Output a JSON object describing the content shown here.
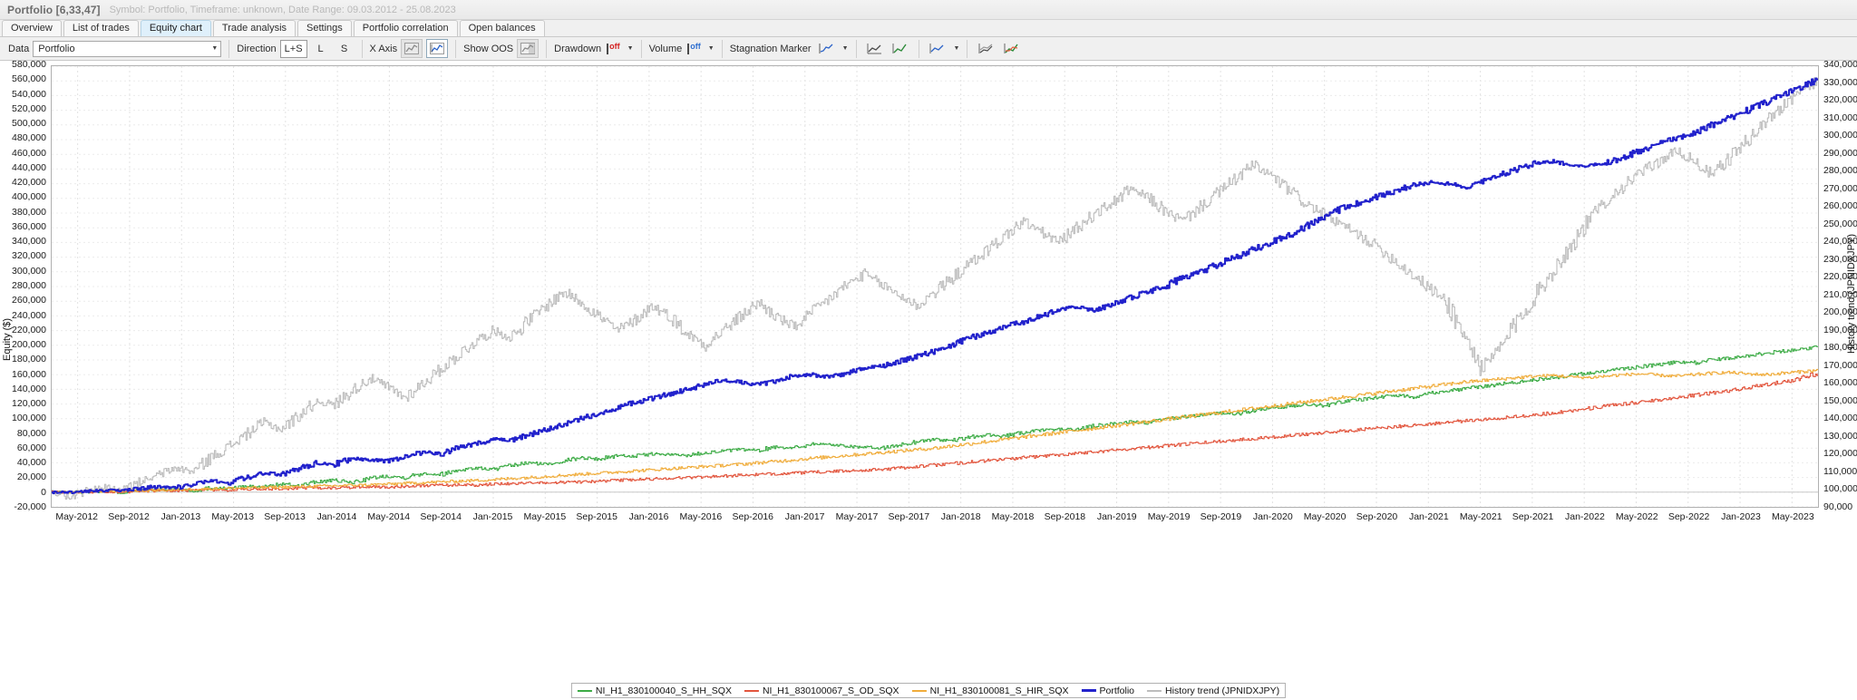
{
  "window": {
    "title": "Portfolio [6,33,47]",
    "subtitle": "Symbol: Portfolio, Timeframe: unknown, Date Range: 09.03.2012 - 25.08.2023"
  },
  "tabs": [
    {
      "label": "Overview",
      "active": false
    },
    {
      "label": "List of trades",
      "active": false
    },
    {
      "label": "Equity chart",
      "active": true
    },
    {
      "label": "Trade analysis",
      "active": false
    },
    {
      "label": "Settings",
      "active": false
    },
    {
      "label": "Portfolio correlation",
      "active": false
    },
    {
      "label": "Open balances",
      "active": false
    }
  ],
  "toolbar": {
    "data_label": "Data",
    "data_value": "Portfolio",
    "direction_label": "Direction",
    "direction_options": [
      "L+S",
      "L",
      "S"
    ],
    "direction_selected": "L+S",
    "xaxis_label": "X Axis",
    "xaxis_icon_1": "chart-line-gray-icon",
    "xaxis_icon_2": "chart-line-time-icon",
    "show_oos_label": "Show OOS",
    "show_oos_icon": "oos-shade-icon",
    "drawdown_label": "Drawdown",
    "drawdown_state": "off",
    "volume_label": "Volume",
    "volume_state": "off",
    "stagnation_label": "Stagnation Marker",
    "stagnation_icon": "stagnation-icon",
    "extra_icons": [
      "equity-line-icon",
      "equity-trend-icon",
      "equity-compare-icon",
      "equity-multi-icon",
      "equity-bars-icon"
    ]
  },
  "chart_data": {
    "type": "line",
    "title": "",
    "xlabel": "",
    "ylabel": "Equity ($)",
    "y2label": "History trend (JPNIDXJPY)",
    "grid": true,
    "legend_position": "bottom",
    "ylim": [
      -20000,
      580000
    ],
    "yticks": [
      -20000,
      0,
      20000,
      40000,
      60000,
      80000,
      100000,
      120000,
      140000,
      160000,
      180000,
      200000,
      220000,
      240000,
      260000,
      280000,
      300000,
      320000,
      340000,
      360000,
      380000,
      400000,
      420000,
      440000,
      460000,
      480000,
      500000,
      520000,
      540000,
      560000,
      580000
    ],
    "ytick_labels": [
      "-20,000",
      "0",
      "20,000",
      "40,000",
      "60,000",
      "80,000",
      "100,000",
      "120,000",
      "140,000",
      "160,000",
      "180,000",
      "200,000",
      "220,000",
      "240,000",
      "260,000",
      "280,000",
      "300,000",
      "320,000",
      "340,000",
      "360,000",
      "380,000",
      "400,000",
      "420,000",
      "440,000",
      "460,000",
      "480,000",
      "500,000",
      "520,000",
      "540,000",
      "560,000",
      "580,000"
    ],
    "y2lim": [
      90000,
      340000
    ],
    "y2ticks": [
      90000,
      100000,
      110000,
      120000,
      130000,
      140000,
      150000,
      160000,
      170000,
      180000,
      190000,
      200000,
      210000,
      220000,
      230000,
      240000,
      250000,
      260000,
      270000,
      280000,
      290000,
      300000,
      310000,
      320000,
      330000,
      340000
    ],
    "y2tick_labels": [
      "90,000",
      "100,000",
      "110,000",
      "120,000",
      "130,000",
      "140,000",
      "150,000",
      "160,000",
      "170,000",
      "180,000",
      "190,000",
      "200,000",
      "210,000",
      "220,000",
      "230,000",
      "240,000",
      "250,000",
      "260,000",
      "270,000",
      "280,000",
      "290,000",
      "300,000",
      "310,000",
      "320,000",
      "330,000",
      "340,000"
    ],
    "xtick_labels": [
      "May-2012",
      "Sep-2012",
      "Jan-2013",
      "May-2013",
      "Sep-2013",
      "Jan-2014",
      "May-2014",
      "Sep-2014",
      "Jan-2015",
      "May-2015",
      "Sep-2015",
      "Jan-2016",
      "May-2016",
      "Sep-2016",
      "Jan-2017",
      "May-2017",
      "Sep-2017",
      "Jan-2018",
      "May-2018",
      "Sep-2018",
      "Jan-2019",
      "May-2019",
      "Sep-2019",
      "Jan-2020",
      "May-2020",
      "Sep-2020",
      "Jan-2021",
      "May-2021",
      "Sep-2021",
      "Jan-2022",
      "May-2022",
      "Sep-2022",
      "Jan-2023",
      "May-2023"
    ],
    "legend": [
      {
        "name": "NI_H1_830100040_S_HH_SQX",
        "color": "#3cab45",
        "axis": "left",
        "width": 1
      },
      {
        "name": "NI_H1_830100067_S_OD_SQX",
        "color": "#e2553d",
        "axis": "left",
        "width": 1
      },
      {
        "name": "NI_H1_830100081_S_HIR_SQX",
        "color": "#f0ac3a",
        "axis": "left",
        "width": 1
      },
      {
        "name": "Portfolio",
        "color": "#2222cc",
        "axis": "left",
        "width": 2
      },
      {
        "name": "History trend (JPNIDXJPY)",
        "color": "#bdbdbd",
        "axis": "right",
        "width": 1
      }
    ],
    "series": [
      {
        "name": "NI_H1_830100040_S_HH_SQX",
        "color": "#3cab45",
        "axis": "left",
        "values": [
          0,
          0,
          500,
          1200,
          -800,
          2500,
          3000,
          4500,
          2000,
          6000,
          5000,
          8000,
          7000,
          11000,
          9000,
          14000,
          16000,
          13000,
          19000,
          22000,
          20000,
          26000,
          24000,
          30000,
          33000,
          31000,
          36000,
          40000,
          38000,
          43000,
          47000,
          45000,
          50000,
          49000,
          52000,
          51000,
          50000,
          54000,
          56000,
          58000,
          57000,
          62000,
          60000,
          66000,
          65000,
          63000,
          61000,
          60000,
          64000,
          69000,
          72000,
          70000,
          75000,
          78000,
          76000,
          81000,
          84000,
          86000,
          85000,
          90000,
          93000,
          96000,
          94000,
          99000,
          102000,
          105000,
          108000,
          106000,
          111000,
          114000,
          117000,
          120000,
          118000,
          123000,
          126000,
          129000,
          132000,
          130000,
          135000,
          138000,
          141000,
          144000,
          147000,
          150000,
          153000,
          156000,
          159000,
          162000,
          165000,
          168000,
          171000,
          174000,
          177000,
          176000,
          180000,
          183000,
          186000,
          189000,
          192000,
          195000,
          198000
        ]
      },
      {
        "name": "NI_H1_830100067_S_OD_SQX",
        "color": "#e2553d",
        "axis": "left",
        "values": [
          0,
          0,
          300,
          800,
          400,
          1500,
          2000,
          1800,
          2600,
          3200,
          2800,
          4000,
          4600,
          4200,
          5400,
          6000,
          5600,
          6800,
          7400,
          7000,
          8200,
          8800,
          9400,
          10000,
          9600,
          11000,
          11600,
          12200,
          12800,
          13400,
          14000,
          15000,
          16000,
          17000,
          18000,
          19000,
          20000,
          21000,
          22000,
          23000,
          24000,
          25000,
          26000,
          27000,
          28000,
          29000,
          30000,
          31000,
          33000,
          35000,
          37000,
          39000,
          41000,
          43000,
          45000,
          47000,
          49000,
          51000,
          53000,
          55000,
          57000,
          59000,
          61000,
          63000,
          65000,
          67000,
          69000,
          71000,
          73000,
          75000,
          77000,
          79000,
          81000,
          83000,
          85000,
          87000,
          89000,
          91000,
          93000,
          95000,
          97000,
          99000,
          101000,
          103000,
          105000,
          108000,
          111000,
          114000,
          117000,
          120000,
          123000,
          126000,
          129000,
          132000,
          135000,
          138000,
          142000,
          146000,
          150000,
          155000,
          162000
        ]
      },
      {
        "name": "NI_H1_830100081_S_HIR_SQX",
        "color": "#f0ac3a",
        "axis": "left",
        "values": [
          0,
          0,
          400,
          1000,
          1600,
          2200,
          2800,
          3400,
          4000,
          4600,
          5200,
          5800,
          6400,
          7000,
          7600,
          8200,
          8800,
          9400,
          10000,
          11000,
          12000,
          13000,
          14000,
          15000,
          16000,
          17000,
          18500,
          20000,
          21500,
          23000,
          24500,
          26000,
          27500,
          29000,
          30500,
          32000,
          33500,
          35000,
          36500,
          38000,
          40000,
          42000,
          44000,
          46000,
          48000,
          50000,
          52000,
          54000,
          56000,
          58000,
          60000,
          63000,
          66000,
          69000,
          72000,
          75000,
          78000,
          81000,
          84000,
          87000,
          90000,
          93000,
          96000,
          99000,
          102000,
          105000,
          108000,
          111000,
          114000,
          117000,
          120000,
          123000,
          126000,
          129000,
          132000,
          135000,
          138000,
          141000,
          144000,
          147000,
          150000,
          152000,
          154000,
          156000,
          158000,
          159000,
          157000,
          156000,
          158000,
          160000,
          161000,
          159000,
          158000,
          160000,
          162000,
          163000,
          161000,
          160000,
          162000,
          164000,
          166000
        ]
      },
      {
        "name": "Portfolio",
        "color": "#2222cc",
        "axis": "left",
        "values": [
          0,
          0,
          1000,
          2500,
          1500,
          5000,
          8000,
          6000,
          11000,
          15000,
          13000,
          20000,
          26000,
          24000,
          32000,
          40000,
          38000,
          46000,
          44000,
          42000,
          48000,
          55000,
          52000,
          60000,
          66000,
          72000,
          70000,
          78000,
          85000,
          92000,
          100000,
          108000,
          115000,
          122000,
          128000,
          134000,
          140000,
          148000,
          152000,
          150000,
          146000,
          152000,
          158000,
          160000,
          157000,
          162000,
          168000,
          172000,
          178000,
          185000,
          192000,
          200000,
          210000,
          218000,
          226000,
          232000,
          240000,
          248000,
          252000,
          248000,
          256000,
          264000,
          272000,
          280000,
          292000,
          300000,
          310000,
          320000,
          330000,
          340000,
          350000,
          362000,
          374000,
          386000,
          394000,
          402000,
          410000,
          418000,
          422000,
          420000,
          416000,
          424000,
          432000,
          440000,
          448000,
          450000,
          446000,
          444000,
          448000,
          456000,
          466000,
          474000,
          482000,
          490000,
          500000,
          510000,
          520000,
          530000,
          540000,
          552000,
          562000
        ]
      },
      {
        "name": "History trend (JPNIDXJPY)",
        "color": "#bdbdbd",
        "axis": "right",
        "values": [
          98000,
          96000,
          99000,
          101000,
          99000,
          104000,
          108000,
          112000,
          110000,
          118000,
          124000,
          131000,
          138000,
          134000,
          142000,
          150000,
          148000,
          156000,
          163000,
          158000,
          152000,
          160000,
          168000,
          176000,
          184000,
          190000,
          186000,
          196000,
          204000,
          212000,
          206000,
          198000,
          190000,
          196000,
          204000,
          198000,
          188000,
          182000,
          190000,
          198000,
          206000,
          198000,
          192000,
          200000,
          208000,
          216000,
          222000,
          216000,
          210000,
          204000,
          212000,
          220000,
          228000,
          236000,
          244000,
          252000,
          246000,
          240000,
          248000,
          256000,
          262000,
          270000,
          266000,
          258000,
          252000,
          260000,
          268000,
          276000,
          284000,
          278000,
          270000,
          262000,
          256000,
          250000,
          244000,
          238000,
          230000,
          222000,
          214000,
          206000,
          186000,
          168000,
          180000,
          196000,
          210000,
          224000,
          238000,
          252000,
          264000,
          272000,
          280000,
          286000,
          292000,
          286000,
          278000,
          288000,
          298000,
          308000,
          318000,
          326000,
          332000
        ]
      }
    ]
  }
}
